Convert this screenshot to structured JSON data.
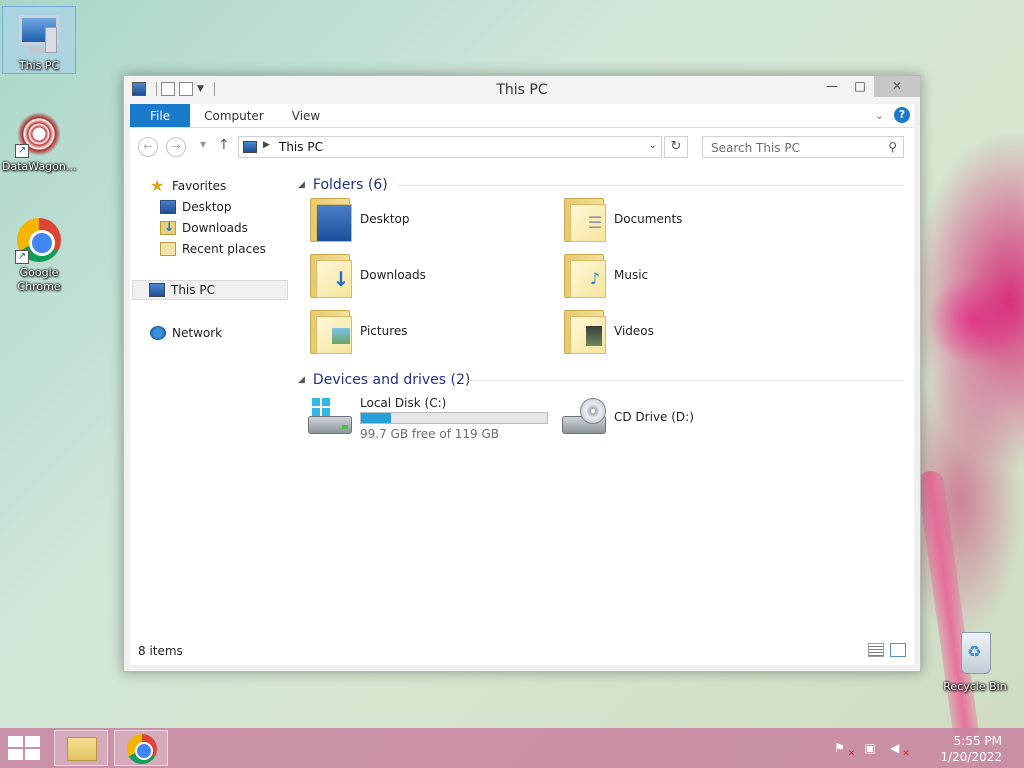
{
  "desktop": {
    "icons": [
      {
        "label": "This PC"
      },
      {
        "label": "DataWagon..."
      },
      {
        "label": "Google Chrome"
      },
      {
        "label": "Recycle Bin"
      }
    ]
  },
  "window": {
    "title": "This PC",
    "minimize": "—",
    "maximize": "□",
    "close": "✕",
    "ribbon_tabs": [
      "File",
      "Computer",
      "View"
    ],
    "help": "?",
    "address": {
      "location": "This PC"
    },
    "search": {
      "placeholder": "Search This PC"
    },
    "nav_pane": {
      "favorites_label": "Favorites",
      "favorites": [
        "Desktop",
        "Downloads",
        "Recent places"
      ],
      "this_pc_label": "This PC",
      "network_label": "Network"
    },
    "folders_group": {
      "title": "Folders (6)",
      "items": [
        "Desktop",
        "Documents",
        "Downloads",
        "Music",
        "Pictures",
        "Videos"
      ]
    },
    "devices_group": {
      "title": "Devices and drives (2)",
      "local_disk": {
        "name": "Local Disk (C:)",
        "free_text": "99.7 GB free of 119 GB",
        "used_fraction": 0.162
      },
      "cd_drive": {
        "name": "CD Drive (D:)"
      }
    },
    "status": {
      "item_count": "8 items"
    }
  },
  "taskbar": {
    "clock_time": "5:55 PM",
    "clock_date": "1/20/2022"
  },
  "colors": {
    "accent": "#1979ca",
    "group_title": "#1e3287",
    "drive_bar": "#26a0da"
  }
}
